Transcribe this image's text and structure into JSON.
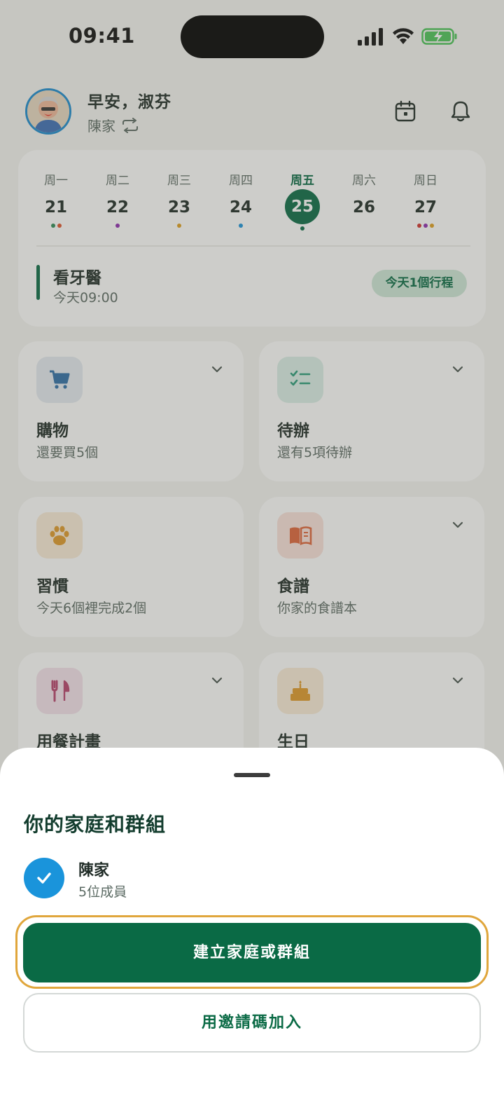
{
  "status": {
    "time": "09:41"
  },
  "header": {
    "greeting": "早安，淑芬",
    "family": "陳家"
  },
  "calendar": {
    "days": [
      {
        "name": "周一",
        "num": "21",
        "dots": [
          "#2e8b57",
          "#e0532d"
        ]
      },
      {
        "name": "周二",
        "num": "22",
        "dots": [
          "#8e2bb0"
        ]
      },
      {
        "name": "周三",
        "num": "23",
        "dots": [
          "#e0a020"
        ]
      },
      {
        "name": "周四",
        "num": "24",
        "dots": [
          "#1a94db"
        ]
      },
      {
        "name": "周五",
        "num": "25",
        "dots": [
          "#0a6a45"
        ],
        "active": true
      },
      {
        "name": "周六",
        "num": "26",
        "dots": []
      },
      {
        "name": "周日",
        "num": "27",
        "dots": [
          "#d0312d",
          "#8e2bb0",
          "#e0a020"
        ]
      }
    ],
    "event": {
      "title": "看牙醫",
      "time": "今天09:00"
    },
    "badge": "今天1個行程"
  },
  "cards": [
    {
      "title": "購物",
      "sub": "還要買5個",
      "icon": "cart-icon",
      "bg": "#e5ebf2",
      "color": "#2f6fa8"
    },
    {
      "title": "待辦",
      "sub": "還有5項待辦",
      "icon": "checklist-icon",
      "bg": "#dcf0e9",
      "color": "#2a9d7a"
    },
    {
      "title": "習慣",
      "sub": "今天6個裡完成2個",
      "icon": "paw-icon",
      "bg": "#fbecd8",
      "color": "#e09a2a"
    },
    {
      "title": "食譜",
      "sub": "你家的食譜本",
      "icon": "book-icon",
      "bg": "#fbe3dc",
      "color": "#e0653a"
    },
    {
      "title": "用餐計畫",
      "sub": "",
      "icon": "utensils-icon",
      "bg": "#f5e3ec",
      "color": "#b8436e"
    },
    {
      "title": "生日",
      "sub": "",
      "icon": "cake-icon",
      "bg": "#fbecd8",
      "color": "#e09a2a"
    }
  ],
  "sheet": {
    "title": "你的家庭和群組",
    "group": {
      "name": "陳家",
      "members": "5位成員"
    },
    "create_label": "建立家庭或群組",
    "join_label": "用邀請碼加入"
  },
  "colors": {
    "primary": "#0a6a45",
    "accent_ring": "#e0a63c",
    "check": "#1a94db"
  }
}
